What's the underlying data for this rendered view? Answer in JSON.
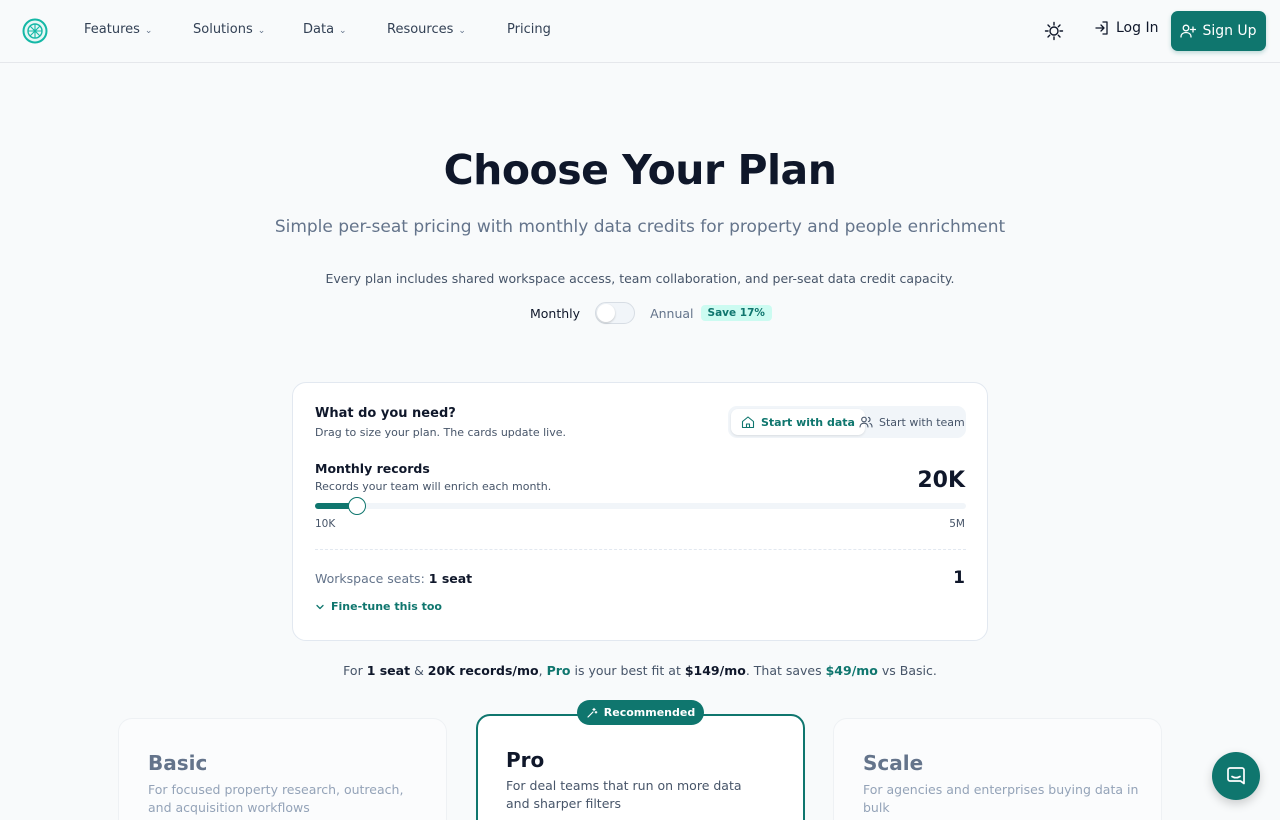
{
  "nav": {
    "items": [
      {
        "label": "Features",
        "dropdown": true
      },
      {
        "label": "Solutions",
        "dropdown": true
      },
      {
        "label": "Data",
        "dropdown": true
      },
      {
        "label": "Resources",
        "dropdown": true
      },
      {
        "label": "Pricing",
        "dropdown": false
      }
    ],
    "login_label": "Log In",
    "signup_label": "Sign Up"
  },
  "hero": {
    "title": "Choose Your Plan",
    "subtitle": "Simple per-seat pricing with monthly data credits for property and people enrichment",
    "note": "Every plan includes shared workspace access, team collaboration, and per-seat data credit capacity."
  },
  "billing": {
    "monthly_label": "Monthly",
    "annual_label": "Annual",
    "save_badge": "Save 17%",
    "annual_selected": false
  },
  "configurator": {
    "title": "What do you need?",
    "subtitle": "Drag to size your plan. The cards update live.",
    "modes": [
      {
        "label": "Start with data",
        "active": true
      },
      {
        "label": "Start with team",
        "active": false
      }
    ],
    "records": {
      "label": "Monthly records",
      "sublabel": "Records your team will enrich each month.",
      "value_display": "20K",
      "slider_fraction": 0.065,
      "min_label": "10K",
      "max_label": "5M"
    },
    "seats": {
      "label": "Workspace seats:",
      "value_text": "1 seat",
      "value": "1"
    },
    "finetune_label": "Fine-tune this too"
  },
  "summary": {
    "p1": "For",
    "seats": "1 seat",
    "amp": "&",
    "records": "20K records/mo",
    "comma": ",",
    "plan": "Pro",
    "p2": "is your best fit at",
    "price": "$149/mo",
    "p3": ". That saves",
    "savings": "$49/mo",
    "p4": "vs Basic."
  },
  "plans": [
    {
      "name": "Basic",
      "description": "For focused property research, outreach, and acquisition workflows"
    },
    {
      "name": "Pro",
      "description": "For deal teams that run on more data and sharper filters",
      "badge": "Recommended"
    },
    {
      "name": "Scale",
      "description": "For agencies and enterprises buying data in bulk"
    }
  ],
  "colors": {
    "accent": "#0f766e",
    "accent_light": "#ccfbf1",
    "text": "#0f172a",
    "muted": "#64748b"
  },
  "icons": {
    "logo": "globe-logo-icon",
    "theme": "sun-icon",
    "login": "login-arrow-icon",
    "signup": "user-plus-icon",
    "mode_data": "building-icon",
    "mode_team": "users-icon",
    "finetune": "chevron-down-icon",
    "badge": "sparkle-icon",
    "chat": "chat-icon"
  }
}
